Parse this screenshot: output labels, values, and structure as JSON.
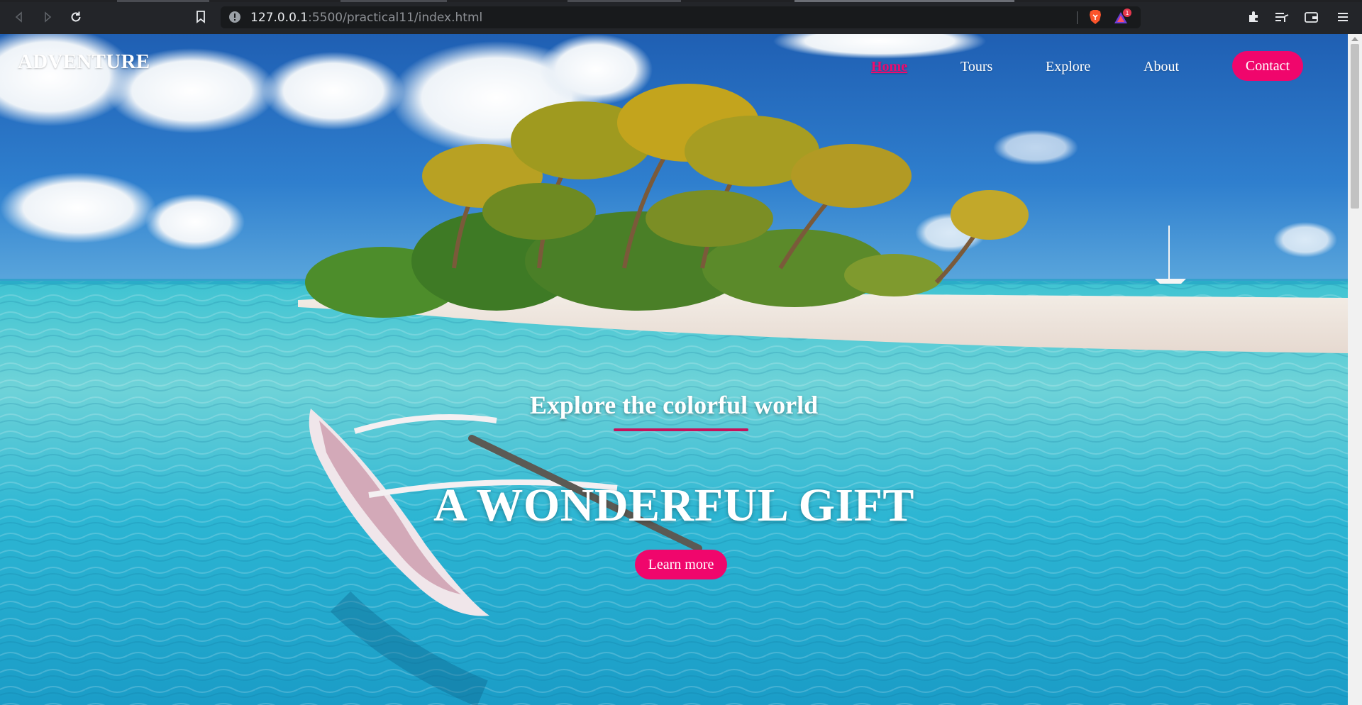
{
  "browser": {
    "address": {
      "host": "127.0.0.1",
      "rest": ":5500/practical11/index.html"
    },
    "notification_count": "1"
  },
  "site": {
    "logo": "ADVENTURE",
    "nav": [
      {
        "label": "Home",
        "active": true
      },
      {
        "label": "Tours",
        "active": false
      },
      {
        "label": "Explore",
        "active": false
      },
      {
        "label": "About",
        "active": false
      }
    ],
    "contact_label": "Contact",
    "accent_color": "#f0066c"
  },
  "hero": {
    "subtitle": "Explore the colorful world",
    "title": "A WONDERFUL GIFT",
    "cta_label": "Learn more",
    "image": "tropical-island-beach-with-canoe"
  }
}
